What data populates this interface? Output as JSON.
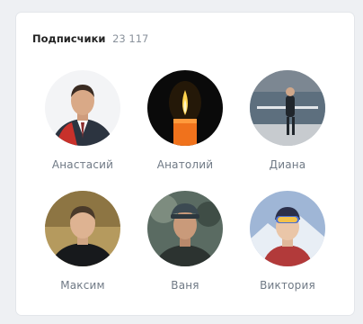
{
  "header": {
    "title": "Подписчики",
    "count": "23 117"
  },
  "followers": [
    {
      "name": "Анастасий",
      "photo": "man-in-suit-photo"
    },
    {
      "name": "Анатолий",
      "photo": "candle-photo"
    },
    {
      "name": "Диана",
      "photo": "woman-by-water-photo"
    },
    {
      "name": "Максим",
      "photo": "man-portrait-photo"
    },
    {
      "name": "Ваня",
      "photo": "man-with-cap-photo"
    },
    {
      "name": "Виктория",
      "photo": "skier-photo"
    }
  ]
}
